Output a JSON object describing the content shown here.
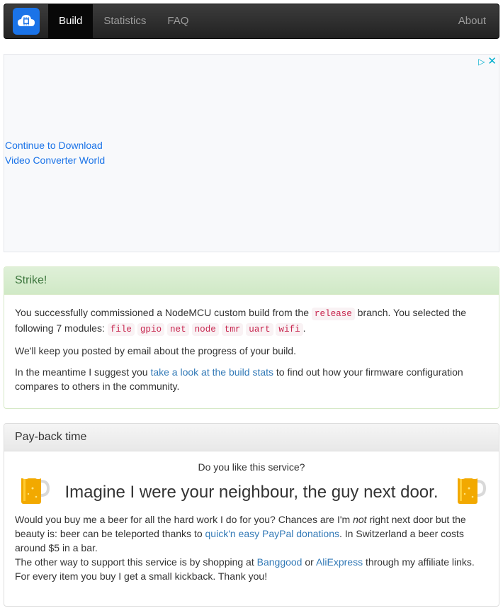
{
  "nav": {
    "items": [
      {
        "label": "Build"
      },
      {
        "label": "Statistics"
      },
      {
        "label": "FAQ"
      }
    ],
    "about_label": "About"
  },
  "ad": {
    "link1": "Continue to Download",
    "link2": "Video Converter World"
  },
  "success_panel": {
    "heading": "Strike!",
    "p1_a": "You successfully commissioned a NodeMCU custom build from the ",
    "branch": "release",
    "p1_b": " branch. You selected the following 7 modules: ",
    "modules": [
      "file",
      "gpio",
      "net",
      "node",
      "tmr",
      "uart",
      "wifi"
    ],
    "p1_end": ".",
    "p2": "We'll keep you posted by email about the progress of your build.",
    "p3_a": "In the meantime I suggest you ",
    "p3_link": "take a look at the build stats",
    "p3_b": " to find out how your firmware configuration compares to others in the community."
  },
  "payback_panel": {
    "heading": "Pay-back time",
    "question": "Do you like this service?",
    "headline": "Imagine I were your neighbour, the guy next door.",
    "t1": "Would you buy me a beer for all the hard work I do for you? Chances are I'm ",
    "t1_em": "not",
    "t1_b": " right next door but the beauty is: beer can be teleported thanks to ",
    "paypal_link": "quick'n easy PayPal donations",
    "t1_c": ". In Switzerland a beer costs around $5 in a bar.",
    "t2_a": "The other way to support this service is by shopping at ",
    "banggood_link": "Banggood",
    "t2_or": " or ",
    "aliexpress_link": "AliExpress",
    "t2_b": " through my affiliate links.",
    "t3": "For every item you buy I get a small kickback. Thank you!"
  }
}
